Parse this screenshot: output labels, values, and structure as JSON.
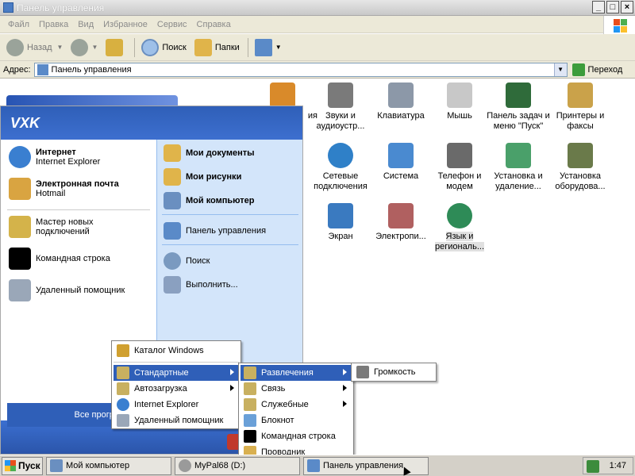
{
  "window": {
    "title": "Панель управления"
  },
  "menubar": [
    "Файл",
    "Правка",
    "Вид",
    "Избранное",
    "Сервис",
    "Справка"
  ],
  "toolbar": {
    "back": "Назад",
    "search": "Поиск",
    "folders": "Папки"
  },
  "address": {
    "label": "Адрес:",
    "value": "Панель управления",
    "go": "Переход"
  },
  "icons": [
    {
      "label": "ия",
      "color": "#d98a2a"
    },
    {
      "label": "Звуки и аудиоустр...",
      "color": "#7a7a7a"
    },
    {
      "label": "Клавиатура",
      "color": "#8c98a8"
    },
    {
      "label": "Мышь",
      "color": "#c8c8c8"
    },
    {
      "label": "Панель задач и меню \"Пуск\"",
      "color": "#2f6b3a"
    },
    {
      "label": "Принтеры и факсы",
      "color": "#caa24a"
    },
    {
      "label": "Сетевые подключения",
      "color": "#2f80c8"
    },
    {
      "label": "Система",
      "color": "#4a8ad0"
    },
    {
      "label": "Телефон и модем",
      "color": "#6a6a6a"
    },
    {
      "label": "Установка и удаление...",
      "color": "#4aa06a"
    },
    {
      "label": "Установка оборудова...",
      "color": "#6a7a4a"
    },
    {
      "label": "Экран",
      "color": "#3a7ac0"
    },
    {
      "label": "Электропи...",
      "color": "#b06060"
    },
    {
      "label": "Язык и региональ...",
      "color": "#2e8b57"
    }
  ],
  "startmenu": {
    "user": "VXK",
    "pinned": [
      {
        "title": "Интернет",
        "sub": "Internet Explorer",
        "color": "#3a7fd0"
      },
      {
        "title": "Электронная почта",
        "sub": "Hotmail",
        "color": "#d9a441"
      }
    ],
    "recent": [
      {
        "label": "Мастер новых подключений",
        "color": "#d4b34a"
      },
      {
        "label": "Командная строка",
        "color": "#000000"
      },
      {
        "label": "Удаленный помощник",
        "color": "#9aa7b8"
      }
    ],
    "right": [
      {
        "label": "Мои документы",
        "bold": true,
        "color": "#e0b44a"
      },
      {
        "label": "Мои рисунки",
        "bold": true,
        "color": "#e0b44a"
      },
      {
        "label": "Мой компьютер",
        "bold": true,
        "color": "#6a8fc0"
      },
      {
        "label": "Панель управления",
        "bold": false,
        "color": "#5a8ac8"
      },
      {
        "label": "Поиск",
        "bold": false,
        "color": "#7a9ac0"
      },
      {
        "label": "Выполнить...",
        "bold": false,
        "color": "#8aa0c0"
      }
    ],
    "all_programs": "Все программы"
  },
  "programs_menu": [
    {
      "label": "Каталог Windows",
      "sub": false,
      "hl": false,
      "color": "#d0a030"
    },
    {
      "label": "Стандартные",
      "sub": true,
      "hl": true,
      "color": "#c8b060"
    },
    {
      "label": "Автозагрузка",
      "sub": true,
      "hl": false,
      "color": "#c8b060"
    },
    {
      "label": "Internet Explorer",
      "sub": false,
      "hl": false,
      "color": "#3a7fd0"
    },
    {
      "label": "Удаленный помощник",
      "sub": false,
      "hl": false,
      "color": "#9aa7b8"
    }
  ],
  "accessories_menu": [
    {
      "label": "Развлечения",
      "sub": true,
      "hl": true,
      "color": "#c8b060"
    },
    {
      "label": "Связь",
      "sub": true,
      "hl": false,
      "color": "#c8b060"
    },
    {
      "label": "Служебные",
      "sub": true,
      "hl": false,
      "color": "#c8b060"
    },
    {
      "label": "Блокнот",
      "sub": false,
      "hl": false,
      "color": "#6aa0d8"
    },
    {
      "label": "Командная строка",
      "sub": false,
      "hl": false,
      "color": "#000000"
    },
    {
      "label": "Проводник",
      "sub": false,
      "hl": false,
      "color": "#d9b050"
    }
  ],
  "entertainment_menu": [
    {
      "label": "Громкость",
      "color": "#7a7a7a"
    }
  ],
  "taskbar": {
    "start": "Пуск",
    "tasks": [
      "Мой компьютер",
      "MyPal68 (D:)",
      "Панель управления"
    ],
    "clock": "1:47"
  },
  "colors": {
    "accent": "#2f5fb8",
    "start_header": "#2f5fb8",
    "taskbar": "#d4d0c8"
  }
}
